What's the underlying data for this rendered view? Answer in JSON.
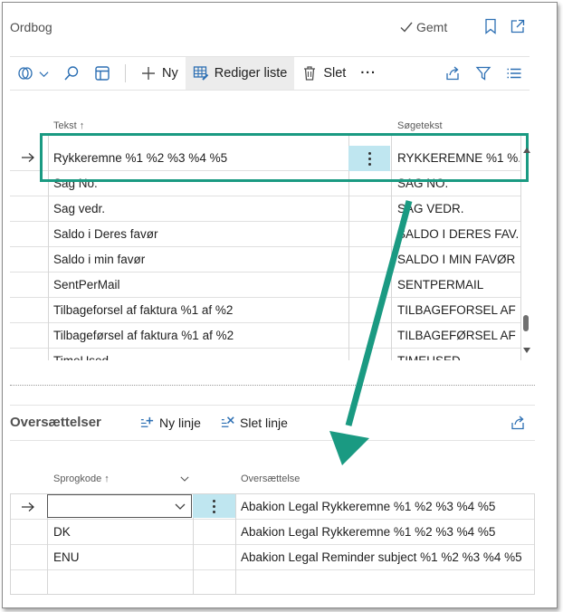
{
  "header": {
    "title": "Ordbog",
    "saved_label": "Gemt"
  },
  "toolbar": {
    "new_label": "Ny",
    "edit_list_label": "Rediger liste",
    "delete_label": "Slet",
    "more_label": "···"
  },
  "main_grid": {
    "columns": [
      "Tekst ↑",
      "Søgetekst"
    ],
    "rows": [
      {
        "text": "Rykkeremne %1 %2 %3 %4 %5",
        "search": "RYKKEREMNE %1 %..."
      },
      {
        "text": "Sag No.",
        "search": "SAG NO."
      },
      {
        "text": "Sag vedr.",
        "search": "SAG VEDR."
      },
      {
        "text": "Saldo i Deres favør",
        "search": "SALDO I DERES FAV..."
      },
      {
        "text": "Saldo i min favør",
        "search": "SALDO I MIN FAVØR"
      },
      {
        "text": "SentPerMail",
        "search": "SENTPERMAIL"
      },
      {
        "text": "Tilbageforsel af faktura %1 af %2",
        "search": "TILBAGEFORSEL AF ..."
      },
      {
        "text": "Tilbageførsel af faktura %1 af %2",
        "search": "TILBAGEFØRSEL AF ..."
      },
      {
        "text": "TimeUsed",
        "search": "TIMEUSED"
      }
    ]
  },
  "translations": {
    "title": "Oversættelser",
    "new_line_label": "Ny linje",
    "delete_line_label": "Slet linje",
    "columns": [
      "Sprogkode ↑",
      "Oversættelse"
    ],
    "rows": [
      {
        "lang": "",
        "translation": "Abakion Legal Rykkeremne %1 %2 %3 %4 %5"
      },
      {
        "lang": "DK",
        "translation": "Abakion Legal Rykkeremne %1 %2 %3 %4 %5"
      },
      {
        "lang": "ENU",
        "translation": "Abakion Legal Reminder subject %1 %2 %3 %4 %5"
      },
      {
        "lang": "",
        "translation": ""
      }
    ]
  },
  "colors": {
    "accent": "#2c6fb3",
    "highlight": "#1a9a82",
    "selected_cell": "#bfe6f0"
  }
}
